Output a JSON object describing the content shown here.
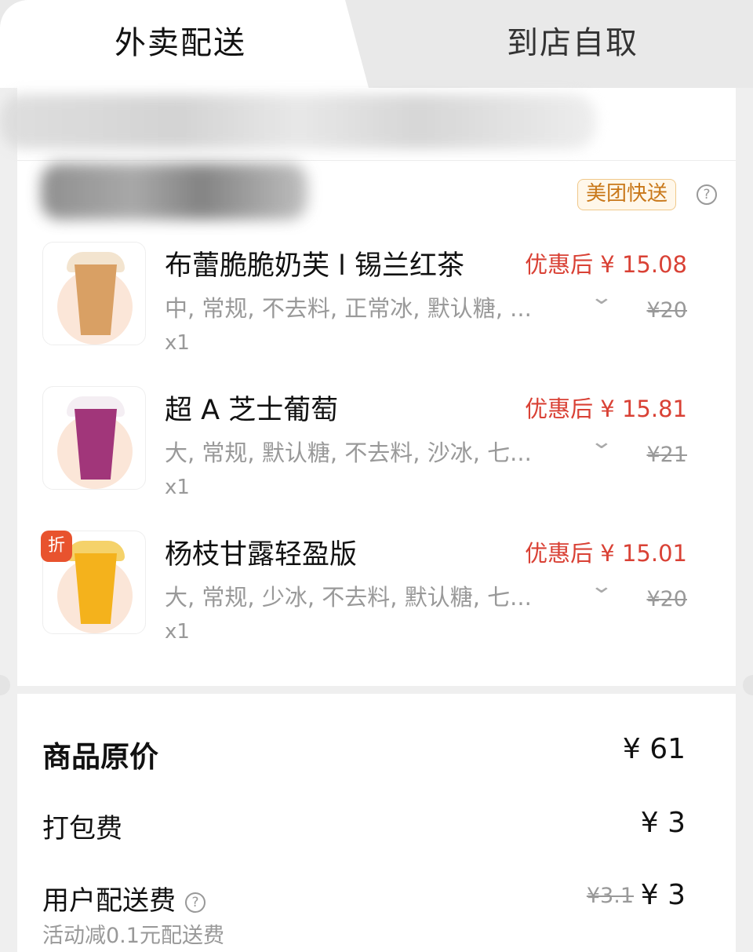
{
  "tabs": {
    "active": "外卖配送",
    "inactive": "到店自取"
  },
  "shop": {
    "delivery_badge": "美团快送",
    "help_glyph": "?"
  },
  "items": [
    {
      "name": "布蕾脆脆奶芙 l 锡兰红茶",
      "price": "优惠后 ¥ 15.08",
      "specs": "中, 常规, 不去料, 正常冰, 默认糖, ...",
      "original_price": "¥20",
      "qty": "x1",
      "colors": {
        "drink": "#d9a064",
        "lid": "#f3e4cf"
      }
    },
    {
      "name": "超 A 芝士葡萄",
      "price": "优惠后 ¥ 15.81",
      "specs": "大, 常规, 默认糖, 不去料, 沙冰, 七...",
      "original_price": "¥21",
      "qty": "x1",
      "colors": {
        "drink": "#a1367a",
        "lid": "#f4eef3"
      }
    },
    {
      "name": "杨枝甘露轻盈版",
      "price": "优惠后 ¥ 15.01",
      "specs": "大, 常规, 少冰, 不去料, 默认糖, 七...",
      "original_price": "¥20",
      "qty": "x1",
      "tag": "折",
      "colors": {
        "drink": "#f4b21c",
        "lid": "#f5d26a"
      }
    }
  ],
  "summary": {
    "original_label": "商品原价",
    "original_value": "¥ 61",
    "packing_label": "打包费",
    "packing_value": "¥ 3",
    "delivery_label": "用户配送费",
    "delivery_help": "?",
    "delivery_orig": "¥3.1",
    "delivery_value": "¥ 3",
    "delivery_note": "活动减0.1元配送费"
  },
  "colors": {
    "price_red": "#d94135",
    "badge_orange": "#c9781a",
    "discount_tag": "#e8532e"
  }
}
